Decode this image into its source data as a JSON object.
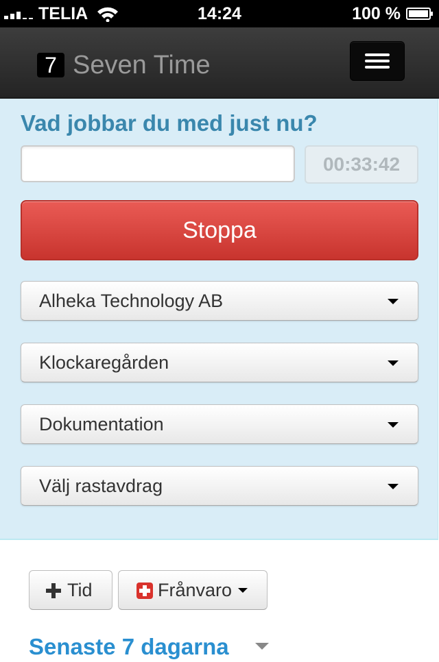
{
  "status_bar": {
    "carrier": "TELIA",
    "time": "14:24",
    "battery": "100 %",
    "icons": [
      "signal-icon",
      "wifi-icon",
      "battery-icon"
    ]
  },
  "navbar": {
    "brand_badge": "7",
    "brand_name": "Seven Time",
    "toggle_icon": "hamburger-menu-icon"
  },
  "tracker": {
    "question": "Vad jobbar du med just nu?",
    "task_value": "",
    "timer": "00:33:42",
    "stop_label": "Stoppa",
    "selects": {
      "customer": "Alheka Technology AB",
      "project": "Klockaregården",
      "activity": "Dokumentation",
      "break": "Välj rastavdrag"
    }
  },
  "actions": {
    "time_label": "Tid",
    "absence_label": "Frånvaro"
  },
  "recent": {
    "title": "Senaste 7 dagarna"
  },
  "colors": {
    "panel_bg": "#d9edf7",
    "heading": "#3a87ad",
    "stop_button": "#d9403a",
    "section_title": "#2a8fd0"
  }
}
